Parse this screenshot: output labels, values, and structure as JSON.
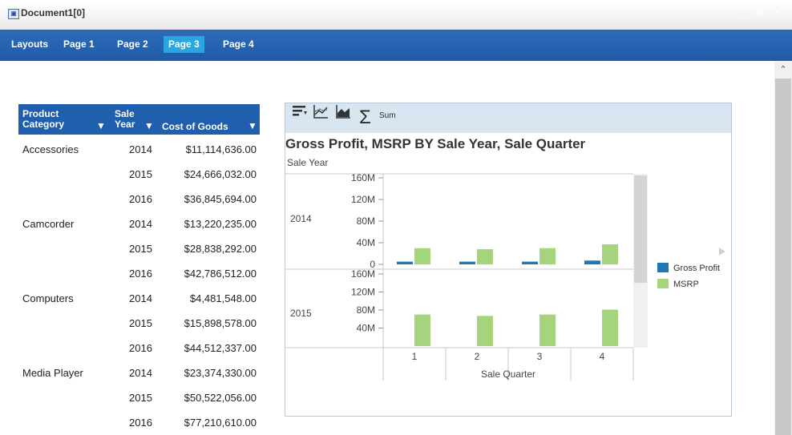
{
  "window": {
    "title": "Document1[0]",
    "controls": "_ ⧉ ✕"
  },
  "tabs": [
    {
      "label": "Layouts",
      "active": false
    },
    {
      "label": "Page 1",
      "active": false
    },
    {
      "label": "Page 2",
      "active": false
    },
    {
      "label": "Page 3",
      "active": true
    },
    {
      "label": "Page 4",
      "active": false
    }
  ],
  "table": {
    "headers": {
      "col1_line1": "Product",
      "col1_line2": "Category",
      "col2_line1": "Sale",
      "col2_line2": "Year",
      "col3": "Cost of Goods",
      "sort_glyph": "▼"
    },
    "rows": [
      {
        "category": "Accessories",
        "year": "2014",
        "cost": "$11,114,636.00"
      },
      {
        "category": "",
        "year": "2015",
        "cost": "$24,666,032.00"
      },
      {
        "category": "",
        "year": "2016",
        "cost": "$36,845,694.00"
      },
      {
        "category": "Camcorder",
        "year": "2014",
        "cost": "$13,220,235.00"
      },
      {
        "category": "",
        "year": "2015",
        "cost": "$28,838,292.00"
      },
      {
        "category": "",
        "year": "2016",
        "cost": "$42,786,512.00"
      },
      {
        "category": "Computers",
        "year": "2014",
        "cost": "$4,481,548.00"
      },
      {
        "category": "",
        "year": "2015",
        "cost": "$15,898,578.00"
      },
      {
        "category": "",
        "year": "2016",
        "cost": "$44,512,337.00"
      },
      {
        "category": "Media Player",
        "year": "2014",
        "cost": "$23,374,330.00"
      },
      {
        "category": "",
        "year": "2015",
        "cost": "$50,522,056.00"
      },
      {
        "category": "",
        "year": "2016",
        "cost": "$77,210,610.00"
      }
    ]
  },
  "chart_toolbar": {
    "icons": [
      "sort-icon",
      "line-chart-icon",
      "area-chart-icon",
      "sigma-icon"
    ],
    "sigma_glyph": "Σ",
    "sum_label": "Sum"
  },
  "chart_data": {
    "type": "bar",
    "title": "Gross Profit, MSRP BY Sale Year, Sale Quarter",
    "row_label": "Sale Year",
    "xlabel": "Sale Quarter",
    "categories": [
      "1",
      "2",
      "3",
      "4"
    ],
    "yticks": [
      "0",
      "40M",
      "80M",
      "120M",
      "160M"
    ],
    "ylim": [
      0,
      160000000
    ],
    "panels": [
      {
        "year": "2014",
        "series": [
          {
            "name": "Gross Profit",
            "values": [
              5000000,
              5000000,
              5000000,
              7000000
            ]
          },
          {
            "name": "MSRP",
            "values": [
              30000000,
              28000000,
              30000000,
              37000000
            ]
          }
        ]
      },
      {
        "year": "2015",
        "series": [
          {
            "name": "Gross Profit",
            "values": [
              null,
              null,
              null,
              null
            ]
          },
          {
            "name": "MSRP",
            "values": [
              70000000,
              67000000,
              70000000,
              81000000
            ]
          }
        ]
      }
    ],
    "legend": [
      {
        "name": "Gross Profit",
        "color": "#1f77b4"
      },
      {
        "name": "MSRP",
        "color": "#a6d47c"
      }
    ],
    "legend_position": "right"
  }
}
